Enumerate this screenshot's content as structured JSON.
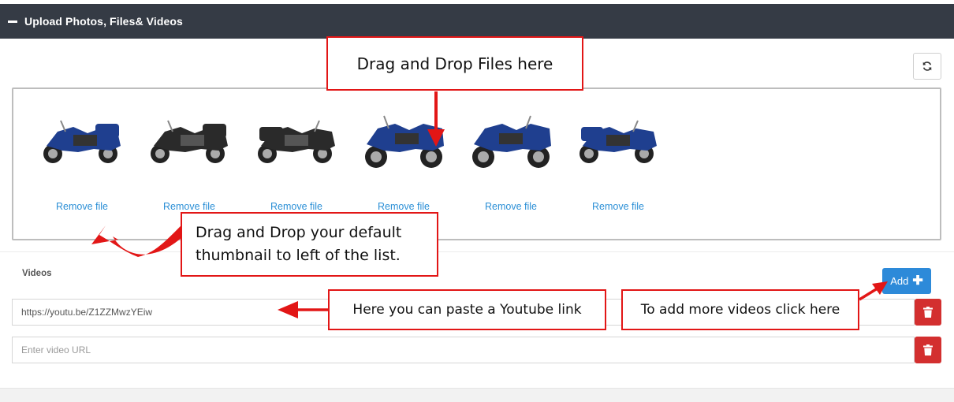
{
  "header": {
    "title": "Upload Photos, Files& Videos"
  },
  "dropzone": {
    "files": [
      {
        "remove_label": "Remove file",
        "color": "#1f3f8f"
      },
      {
        "remove_label": "Remove file",
        "color": "#2a2a2a"
      },
      {
        "remove_label": "Remove file",
        "color": "#2a2a2a"
      },
      {
        "remove_label": "Remove file",
        "color": "#1f3f8f"
      },
      {
        "remove_label": "Remove file",
        "color": "#1f3f8f"
      },
      {
        "remove_label": "Remove file",
        "color": "#1f3f8f"
      }
    ]
  },
  "videos": {
    "label": "Videos",
    "add_label": "Add",
    "rows": [
      {
        "value": "https://youtu.be/Z1ZZMwzYEiw",
        "placeholder": ""
      },
      {
        "value": "",
        "placeholder": "Enter video URL"
      }
    ]
  },
  "annotations": {
    "drag_drop_files": "Drag and Drop Files here",
    "default_thumb_line1": "Drag and Drop your default",
    "default_thumb_line2": "thumbnail to left of the list.",
    "paste_youtube": "Here you can paste a Youtube link",
    "add_more_videos": "To add more videos click here"
  },
  "colors": {
    "header_bg": "#353b45",
    "link": "#2b8fd6",
    "add_button": "#2d8ad9",
    "delete_button": "#d32f2f",
    "annotation": "#e21616"
  },
  "icons": {
    "collapse": "minus-icon",
    "refresh": "refresh-icon",
    "add": "plus-icon",
    "delete": "trash-icon"
  }
}
